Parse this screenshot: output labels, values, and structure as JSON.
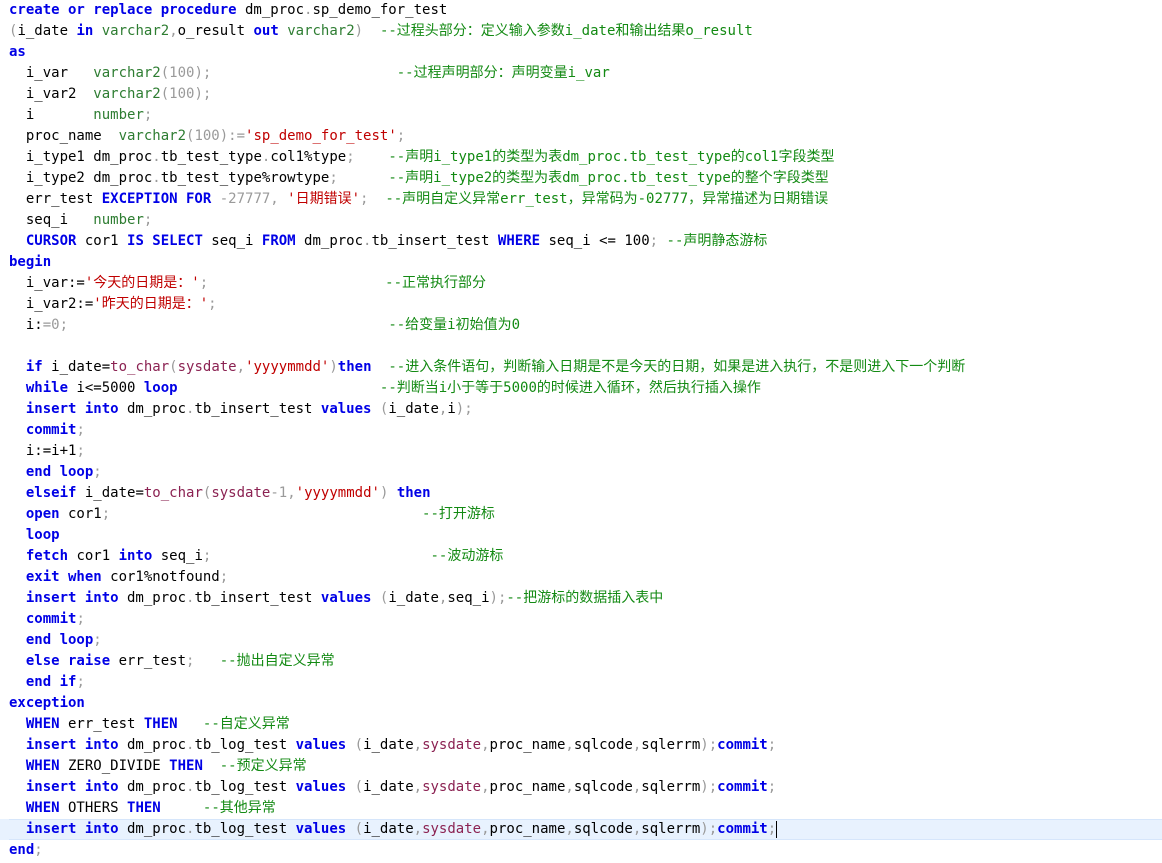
{
  "editor": {
    "language": "sql",
    "current_line": 39,
    "lines": [
      [
        [
          "kw",
          "create or replace procedure"
        ],
        [
          "tx",
          " dm_proc"
        ],
        [
          "pu",
          "."
        ],
        [
          "tx",
          "sp_demo_for_test"
        ]
      ],
      [
        [
          "pu",
          "("
        ],
        [
          "tx",
          "i_date "
        ],
        [
          "kw",
          "in"
        ],
        [
          "tx",
          " "
        ],
        [
          "ty",
          "varchar2"
        ],
        [
          "pu",
          ","
        ],
        [
          "tx",
          "o_result "
        ],
        [
          "kw",
          "out"
        ],
        [
          "tx",
          " "
        ],
        [
          "ty",
          "varchar2"
        ],
        [
          "pu",
          ")"
        ],
        [
          "tx",
          "  "
        ],
        [
          "cm",
          "--过程头部分：定义输入参数i_date和输出结果o_result"
        ]
      ],
      [
        [
          "kw",
          "as"
        ]
      ],
      [
        [
          "tx",
          "  i_var   "
        ],
        [
          "ty",
          "varchar2"
        ],
        [
          "pu",
          "(100);"
        ],
        [
          "tx",
          "                      "
        ],
        [
          "cm",
          "--过程声明部分：声明变量i_var"
        ]
      ],
      [
        [
          "tx",
          "  i_var2  "
        ],
        [
          "ty",
          "varchar2"
        ],
        [
          "pu",
          "(100);"
        ]
      ],
      [
        [
          "tx",
          "  i       "
        ],
        [
          "ty",
          "number"
        ],
        [
          "pu",
          ";"
        ]
      ],
      [
        [
          "tx",
          "  proc_name  "
        ],
        [
          "ty",
          "varchar2"
        ],
        [
          "pu",
          "(100):="
        ],
        [
          "st",
          "'sp_demo_for_test'"
        ],
        [
          "pu",
          ";"
        ]
      ],
      [
        [
          "tx",
          "  i_type1 dm_proc"
        ],
        [
          "pu",
          "."
        ],
        [
          "tx",
          "tb_test_type"
        ],
        [
          "pu",
          "."
        ],
        [
          "tx",
          "col1%type"
        ],
        [
          "pu",
          ";"
        ],
        [
          "tx",
          "    "
        ],
        [
          "cm",
          "--声明i_type1的类型为表dm_proc.tb_test_type的col1字段类型"
        ]
      ],
      [
        [
          "tx",
          "  i_type2 dm_proc"
        ],
        [
          "pu",
          "."
        ],
        [
          "tx",
          "tb_test_type%rowtype"
        ],
        [
          "pu",
          ";"
        ],
        [
          "tx",
          "      "
        ],
        [
          "cm",
          "--声明i_type2的类型为表dm_proc.tb_test_type的整个字段类型"
        ]
      ],
      [
        [
          "tx",
          "  err_test "
        ],
        [
          "kw",
          "EXCEPTION FOR"
        ],
        [
          "tx",
          " "
        ],
        [
          "pu",
          "-27777, "
        ],
        [
          "st",
          "'日期错误'"
        ],
        [
          "pu",
          ";"
        ],
        [
          "tx",
          "  "
        ],
        [
          "cm",
          "--声明自定义异常err_test，异常码为-02777，异常描述为日期错误"
        ]
      ],
      [
        [
          "tx",
          "  seq_i   "
        ],
        [
          "ty",
          "number"
        ],
        [
          "pu",
          ";"
        ]
      ],
      [
        [
          "tx",
          "  "
        ],
        [
          "kw",
          "CURSOR"
        ],
        [
          "tx",
          " cor1 "
        ],
        [
          "kw",
          "IS SELECT"
        ],
        [
          "tx",
          " seq_i "
        ],
        [
          "kw",
          "FROM"
        ],
        [
          "tx",
          " dm_proc"
        ],
        [
          "pu",
          "."
        ],
        [
          "tx",
          "tb_insert_test "
        ],
        [
          "kw",
          "WHERE"
        ],
        [
          "tx",
          " seq_i <= 100"
        ],
        [
          "pu",
          ";"
        ],
        [
          "tx",
          " "
        ],
        [
          "cm",
          "--声明静态游标"
        ]
      ],
      [
        [
          "kw",
          "begin"
        ]
      ],
      [
        [
          "tx",
          "  i_var:="
        ],
        [
          "st",
          "'今天的日期是：'"
        ],
        [
          "pu",
          ";"
        ],
        [
          "tx",
          "                     "
        ],
        [
          "cm",
          "--正常执行部分"
        ]
      ],
      [
        [
          "tx",
          "  i_var2:="
        ],
        [
          "st",
          "'昨天的日期是：'"
        ],
        [
          "pu",
          ";"
        ]
      ],
      [
        [
          "tx",
          "  i:"
        ],
        [
          "pu",
          "=0;"
        ],
        [
          "tx",
          "                                      "
        ],
        [
          "cm",
          "--给变量i初始值为0"
        ]
      ],
      [],
      [
        [
          "tx",
          "  "
        ],
        [
          "kw",
          "if"
        ],
        [
          "tx",
          " i_date="
        ],
        [
          "fn",
          "to_char"
        ],
        [
          "pu",
          "("
        ],
        [
          "fn",
          "sysdate"
        ],
        [
          "pu",
          ","
        ],
        [
          "st",
          "'yyyymmdd'"
        ],
        [
          "pu",
          ")"
        ],
        [
          "kw",
          "then"
        ],
        [
          "tx",
          "  "
        ],
        [
          "cm",
          "--进入条件语句，判断输入日期是不是今天的日期，如果是进入执行，不是则进入下一个判断"
        ]
      ],
      [
        [
          "tx",
          "  "
        ],
        [
          "kw",
          "while"
        ],
        [
          "tx",
          " i<=5000 "
        ],
        [
          "kw",
          "loop"
        ],
        [
          "tx",
          "                        "
        ],
        [
          "cm",
          "--判断当i小于等于5000的时候进入循环，然后执行插入操作"
        ]
      ],
      [
        [
          "tx",
          "  "
        ],
        [
          "kw",
          "insert into"
        ],
        [
          "tx",
          " dm_proc"
        ],
        [
          "pu",
          "."
        ],
        [
          "tx",
          "tb_insert_test "
        ],
        [
          "kw",
          "values"
        ],
        [
          "tx",
          " "
        ],
        [
          "pu",
          "("
        ],
        [
          "tx",
          "i_date"
        ],
        [
          "pu",
          ","
        ],
        [
          "tx",
          "i"
        ],
        [
          "pu",
          ");"
        ]
      ],
      [
        [
          "tx",
          "  "
        ],
        [
          "kw",
          "commit"
        ],
        [
          "pu",
          ";"
        ]
      ],
      [
        [
          "tx",
          "  i:=i+1"
        ],
        [
          "pu",
          ";"
        ]
      ],
      [
        [
          "tx",
          "  "
        ],
        [
          "kw",
          "end loop"
        ],
        [
          "pu",
          ";"
        ]
      ],
      [
        [
          "tx",
          "  "
        ],
        [
          "kw",
          "elseif"
        ],
        [
          "tx",
          " i_date="
        ],
        [
          "fn",
          "to_char"
        ],
        [
          "pu",
          "("
        ],
        [
          "fn",
          "sysdate"
        ],
        [
          "pu",
          "-1,"
        ],
        [
          "st",
          "'yyyymmdd'"
        ],
        [
          "pu",
          ")"
        ],
        [
          "tx",
          " "
        ],
        [
          "kw",
          "then"
        ]
      ],
      [
        [
          "tx",
          "  "
        ],
        [
          "kw",
          "open"
        ],
        [
          "tx",
          " cor1"
        ],
        [
          "pu",
          ";"
        ],
        [
          "tx",
          "                                     "
        ],
        [
          "cm",
          "--打开游标"
        ]
      ],
      [
        [
          "tx",
          "  "
        ],
        [
          "kw",
          "loop"
        ]
      ],
      [
        [
          "tx",
          "  "
        ],
        [
          "kw",
          "fetch"
        ],
        [
          "tx",
          " cor1 "
        ],
        [
          "kw",
          "into"
        ],
        [
          "tx",
          " seq_i"
        ],
        [
          "pu",
          ";"
        ],
        [
          "tx",
          "                          "
        ],
        [
          "cm",
          "--波动游标"
        ]
      ],
      [
        [
          "tx",
          "  "
        ],
        [
          "kw",
          "exit when"
        ],
        [
          "tx",
          " cor1%notfound"
        ],
        [
          "pu",
          ";"
        ]
      ],
      [
        [
          "tx",
          "  "
        ],
        [
          "kw",
          "insert into"
        ],
        [
          "tx",
          " dm_proc"
        ],
        [
          "pu",
          "."
        ],
        [
          "tx",
          "tb_insert_test "
        ],
        [
          "kw",
          "values"
        ],
        [
          "tx",
          " "
        ],
        [
          "pu",
          "("
        ],
        [
          "tx",
          "i_date"
        ],
        [
          "pu",
          ","
        ],
        [
          "tx",
          "seq_i"
        ],
        [
          "pu",
          ");"
        ],
        [
          "cm",
          "--把游标的数据插入表中"
        ]
      ],
      [
        [
          "tx",
          "  "
        ],
        [
          "kw",
          "commit"
        ],
        [
          "pu",
          ";"
        ]
      ],
      [
        [
          "tx",
          "  "
        ],
        [
          "kw",
          "end loop"
        ],
        [
          "pu",
          ";"
        ]
      ],
      [
        [
          "tx",
          "  "
        ],
        [
          "kw",
          "else raise"
        ],
        [
          "tx",
          " err_test"
        ],
        [
          "pu",
          ";"
        ],
        [
          "tx",
          "   "
        ],
        [
          "cm",
          "--抛出自定义异常"
        ]
      ],
      [
        [
          "tx",
          "  "
        ],
        [
          "kw",
          "end if"
        ],
        [
          "pu",
          ";"
        ]
      ],
      [
        [
          "kw",
          "exception"
        ]
      ],
      [
        [
          "tx",
          "  "
        ],
        [
          "kw",
          "WHEN"
        ],
        [
          "tx",
          " err_test "
        ],
        [
          "kw",
          "THEN"
        ],
        [
          "tx",
          "   "
        ],
        [
          "cm",
          "--自定义异常"
        ]
      ],
      [
        [
          "tx",
          "  "
        ],
        [
          "kw",
          "insert into"
        ],
        [
          "tx",
          " dm_proc"
        ],
        [
          "pu",
          "."
        ],
        [
          "tx",
          "tb_log_test "
        ],
        [
          "kw",
          "values"
        ],
        [
          "tx",
          " "
        ],
        [
          "pu",
          "("
        ],
        [
          "tx",
          "i_date"
        ],
        [
          "pu",
          ","
        ],
        [
          "fn",
          "sysdate"
        ],
        [
          "pu",
          ","
        ],
        [
          "tx",
          "proc_name"
        ],
        [
          "pu",
          ","
        ],
        [
          "tx",
          "sqlcode"
        ],
        [
          "pu",
          ","
        ],
        [
          "tx",
          "sqlerrm"
        ],
        [
          "pu",
          ");"
        ],
        [
          "kw",
          "commit"
        ],
        [
          "pu",
          ";"
        ]
      ],
      [
        [
          "tx",
          "  "
        ],
        [
          "kw",
          "WHEN"
        ],
        [
          "tx",
          " ZERO_DIVIDE "
        ],
        [
          "kw",
          "THEN"
        ],
        [
          "tx",
          "  "
        ],
        [
          "cm",
          "--预定义异常"
        ]
      ],
      [
        [
          "tx",
          "  "
        ],
        [
          "kw",
          "insert into"
        ],
        [
          "tx",
          " dm_proc"
        ],
        [
          "pu",
          "."
        ],
        [
          "tx",
          "tb_log_test "
        ],
        [
          "kw",
          "values"
        ],
        [
          "tx",
          " "
        ],
        [
          "pu",
          "("
        ],
        [
          "tx",
          "i_date"
        ],
        [
          "pu",
          ","
        ],
        [
          "fn",
          "sysdate"
        ],
        [
          "pu",
          ","
        ],
        [
          "tx",
          "proc_name"
        ],
        [
          "pu",
          ","
        ],
        [
          "tx",
          "sqlcode"
        ],
        [
          "pu",
          ","
        ],
        [
          "tx",
          "sqlerrm"
        ],
        [
          "pu",
          ");"
        ],
        [
          "kw",
          "commit"
        ],
        [
          "pu",
          ";"
        ]
      ],
      [
        [
          "tx",
          "  "
        ],
        [
          "kw",
          "WHEN"
        ],
        [
          "tx",
          " OTHERS "
        ],
        [
          "kw",
          "THEN"
        ],
        [
          "tx",
          "     "
        ],
        [
          "cm",
          "--其他异常"
        ]
      ],
      [
        [
          "tx",
          "  "
        ],
        [
          "kw",
          "insert into"
        ],
        [
          "tx",
          " dm_proc"
        ],
        [
          "pu",
          "."
        ],
        [
          "tx",
          "tb_log_test "
        ],
        [
          "kw",
          "values"
        ],
        [
          "tx",
          " "
        ],
        [
          "pu",
          "("
        ],
        [
          "tx",
          "i_date"
        ],
        [
          "pu",
          ","
        ],
        [
          "fn",
          "sysdate"
        ],
        [
          "pu",
          ","
        ],
        [
          "tx",
          "proc_name"
        ],
        [
          "pu",
          ","
        ],
        [
          "tx",
          "sqlcode"
        ],
        [
          "pu",
          ","
        ],
        [
          "tx",
          "sqlerrm"
        ],
        [
          "pu",
          ");"
        ],
        [
          "kw",
          "commit"
        ],
        [
          "pu",
          ";"
        ]
      ],
      [
        [
          "kw",
          "end"
        ],
        [
          "pu",
          ";"
        ]
      ]
    ]
  }
}
